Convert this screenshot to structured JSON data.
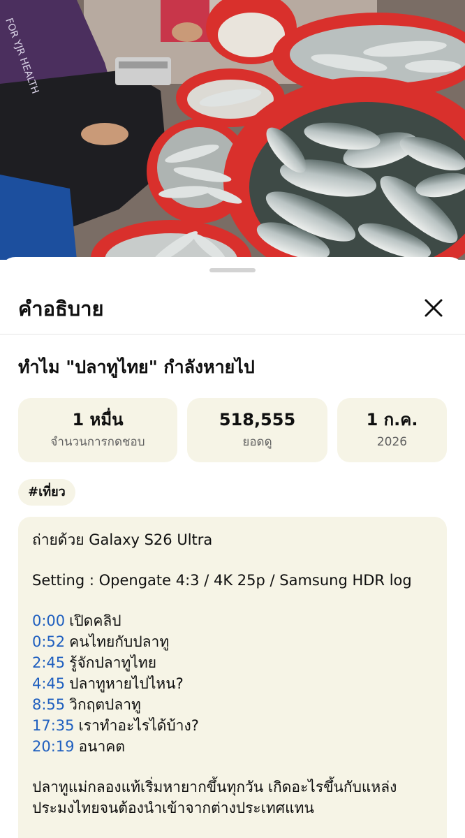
{
  "sheet": {
    "title": "คำอธิบาย",
    "close_icon": "close-icon"
  },
  "video": {
    "title": "ทำไม \"ปลาทูไทย\" กำลังหายไป"
  },
  "stats": {
    "likes": {
      "value": "1 หมื่น",
      "label": "จำนวนการกดชอบ"
    },
    "views": {
      "value": "518,555",
      "label": "ยอดดู"
    },
    "date": {
      "value": "1 ก.ค.",
      "label": "2026"
    }
  },
  "hashtag": "#เที่ยว",
  "description": {
    "shot_with": "ถ่ายด้วย Galaxy S26 Ultra",
    "setting": "Setting : Opengate 4:3 / 4K 25p / Samsung HDR log",
    "chapters": [
      {
        "time": "0:00",
        "label": "เปิดคลิป"
      },
      {
        "time": "0:52",
        "label": "คนไทยกับปลาทู"
      },
      {
        "time": "2:45",
        "label": "รู้จักปลาทูไทย"
      },
      {
        "time": "4:45",
        "label": "ปลาทูหายไปไหน?"
      },
      {
        "time": "8:55",
        "label": "วิกฤตปลาทู"
      },
      {
        "time": "17:35",
        "label": "เราทำอะไรได้บ้าง?"
      },
      {
        "time": "20:19",
        "label": "อนาคต"
      }
    ],
    "paragraph_line1": "ปลาทูแม่กลองแท้เริ่มหายากขึ้นทุกวัน เกิดอะไรขึ้นกับแหล่ง",
    "paragraph_line2": "ประมงไทยจนต้องนำเข้าจากต่างประเทศแทน"
  },
  "thumbnail": {
    "shirt_text": "FOR YJR HEALTH"
  },
  "colors": {
    "card_bg": "#f6f4e6",
    "timestamp_link": "#1f5fbf",
    "basket_red": "#d9302c"
  }
}
